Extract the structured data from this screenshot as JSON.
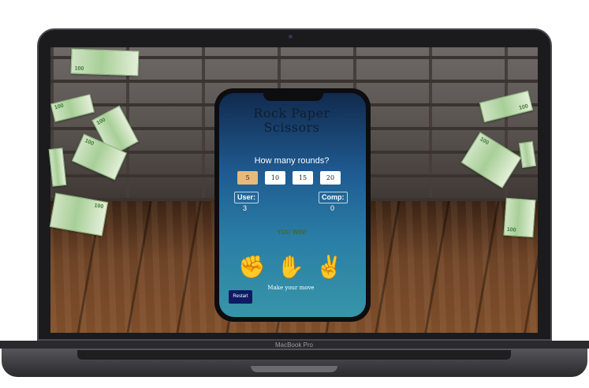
{
  "device": {
    "brand": "MacBook Pro"
  },
  "game": {
    "title": "Rock Paper Scissors",
    "question": "How many rounds?",
    "rounds": [
      "5",
      "10",
      "15",
      "20"
    ],
    "selected_round": "5",
    "scores": {
      "user_label": "User:",
      "user_value": "3",
      "comp_label": "Comp:",
      "comp_value": "0"
    },
    "result": "YOU WIN!",
    "moves": [
      "rock",
      "paper",
      "scissors"
    ],
    "prompt": "Make your move",
    "restart_label": "Restart"
  },
  "decor": {
    "banknote_value": "100"
  },
  "colors": {
    "selected_round": "#e9b97a",
    "restart_button": "#0e1a63",
    "screen_top": "#112a4e",
    "screen_bottom": "#3795a8",
    "result_text": "#3f6a36"
  }
}
